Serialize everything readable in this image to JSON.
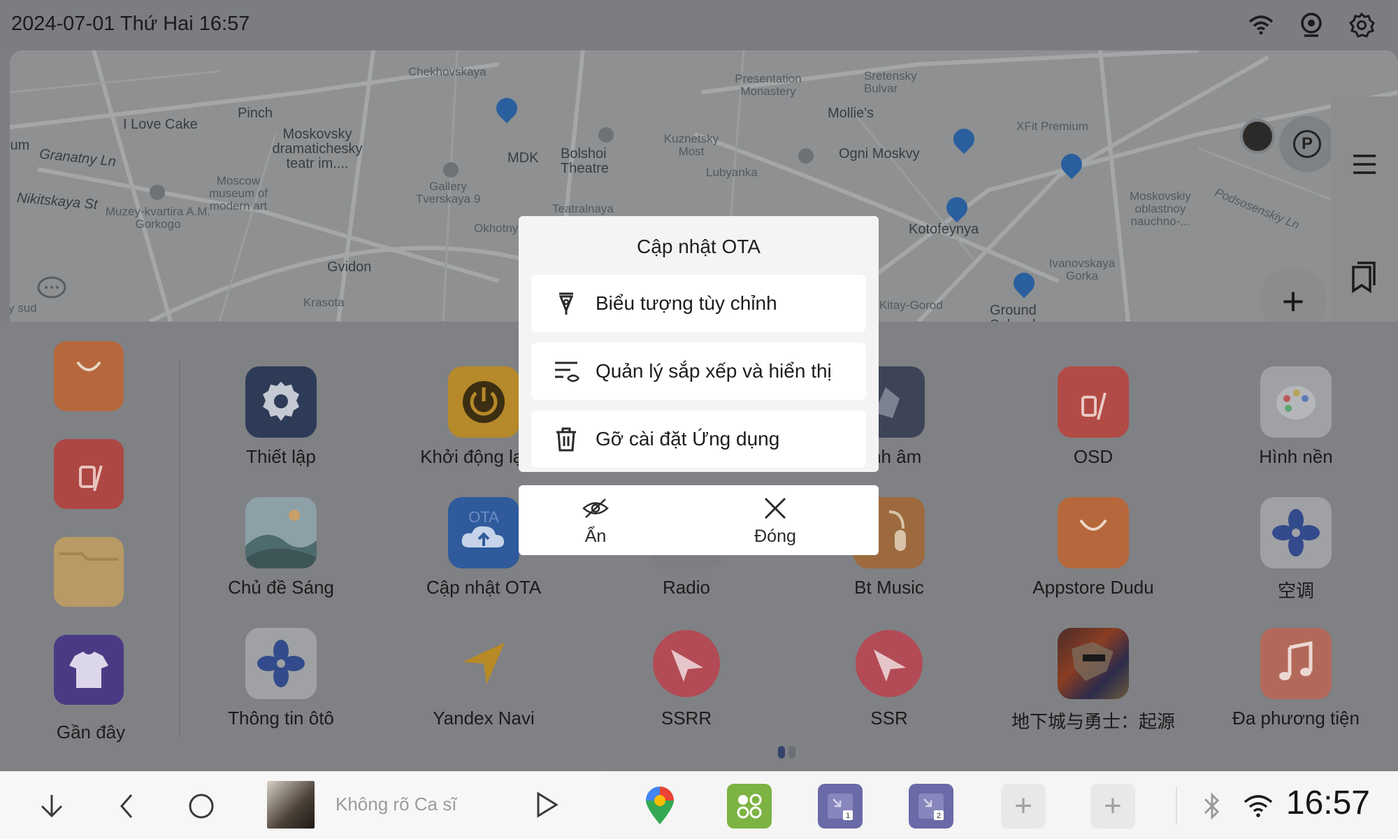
{
  "status": {
    "datetime": "2024-07-01 Thứ Hai 16:57",
    "icons": [
      "wifi-icon",
      "camera-icon",
      "settings-icon"
    ]
  },
  "map": {
    "labels": [
      "Chekhovskaya",
      "Presentation Monastery",
      "Sretensky Bulvar",
      "Pinch",
      "I Love Cake",
      "Moskovsky dramatichesky teatr im....",
      "Mollie's",
      "XFit Premium",
      "Granatny Ln",
      "MDK",
      "Bolshoi Theatre",
      "Kuznetsky Most",
      "Lubyanka",
      "Ogni Moskvy",
      "Moscow museum of modern art",
      "Nikitskaya St",
      "Muzey-kvartira A.M. Gorkogo",
      "Gallery Tverskaya 9",
      "Teatralnaya",
      "Okhotny",
      "Kotofeynya",
      "Moskovskiy oblastnoy nauchno-...",
      "Podsosenskiy Ln",
      "Gvidon",
      "Ivanovskaya Gorka",
      "Krasota",
      "Kitay-Gorod",
      "Ground Solyanka",
      "ium",
      "y sud"
    ]
  },
  "drawer": {
    "recent_label": "Gần đây",
    "apps": [
      {
        "label": "Thiết lập",
        "icon": "settings-gear-icon"
      },
      {
        "label": "Khởi động lại M",
        "icon": "power-icon"
      },
      {
        "label": "hỉnh âm",
        "icon": "sound-tuning-icon"
      },
      {
        "label": "OSD",
        "icon": "fuel-gauge-icon"
      },
      {
        "label": "Hình nền",
        "icon": "palette-icon"
      },
      {
        "label": "Chủ đề Sáng",
        "icon": "landscape-icon"
      },
      {
        "label": "Cập nhật OTA",
        "icon": "cloud-upload-icon"
      },
      {
        "label": "Radio",
        "icon": "radio-icon"
      },
      {
        "label": "Bt Music",
        "icon": "bluetooth-music-icon"
      },
      {
        "label": "Appstore Dudu",
        "icon": "shopping-bag-icon"
      },
      {
        "label": "空调",
        "icon": "fan-icon"
      },
      {
        "label": "Thông tin ôtô",
        "icon": "fan-icon"
      },
      {
        "label": "Yandex Navi",
        "icon": "navigation-arrow-icon"
      },
      {
        "label": "SSRR",
        "icon": "paper-plane-icon"
      },
      {
        "label": "SSR",
        "icon": "paper-plane-icon"
      },
      {
        "label": "地下城与勇士：起源",
        "icon": "game-cover-icon"
      },
      {
        "label": "Đa phương tiện",
        "icon": "music-note-icon"
      }
    ]
  },
  "popup": {
    "title": "Cập nhật OTA",
    "items": [
      {
        "label": "Biểu tượng tùy chỉnh"
      },
      {
        "label": "Quản lý sắp xếp và hiển thị"
      },
      {
        "label": "Gỡ cài đặt Ứng dụng"
      }
    ],
    "hide_label": "Ẩn",
    "close_label": "Đóng"
  },
  "bottombar": {
    "artist": "Không rõ Ca sĩ",
    "clock": "16:57",
    "shortcut_badges": [
      "1",
      "2"
    ]
  },
  "colors": {
    "popup_bg": "#f4f4f4",
    "overlay": "#7f8184",
    "settings_tile": "#2d3b57",
    "power_tile": "#b6892a",
    "osd_tile": "#b24b45",
    "ota_tile": "#2f5a9c",
    "fan_tile": "#334a8c"
  }
}
